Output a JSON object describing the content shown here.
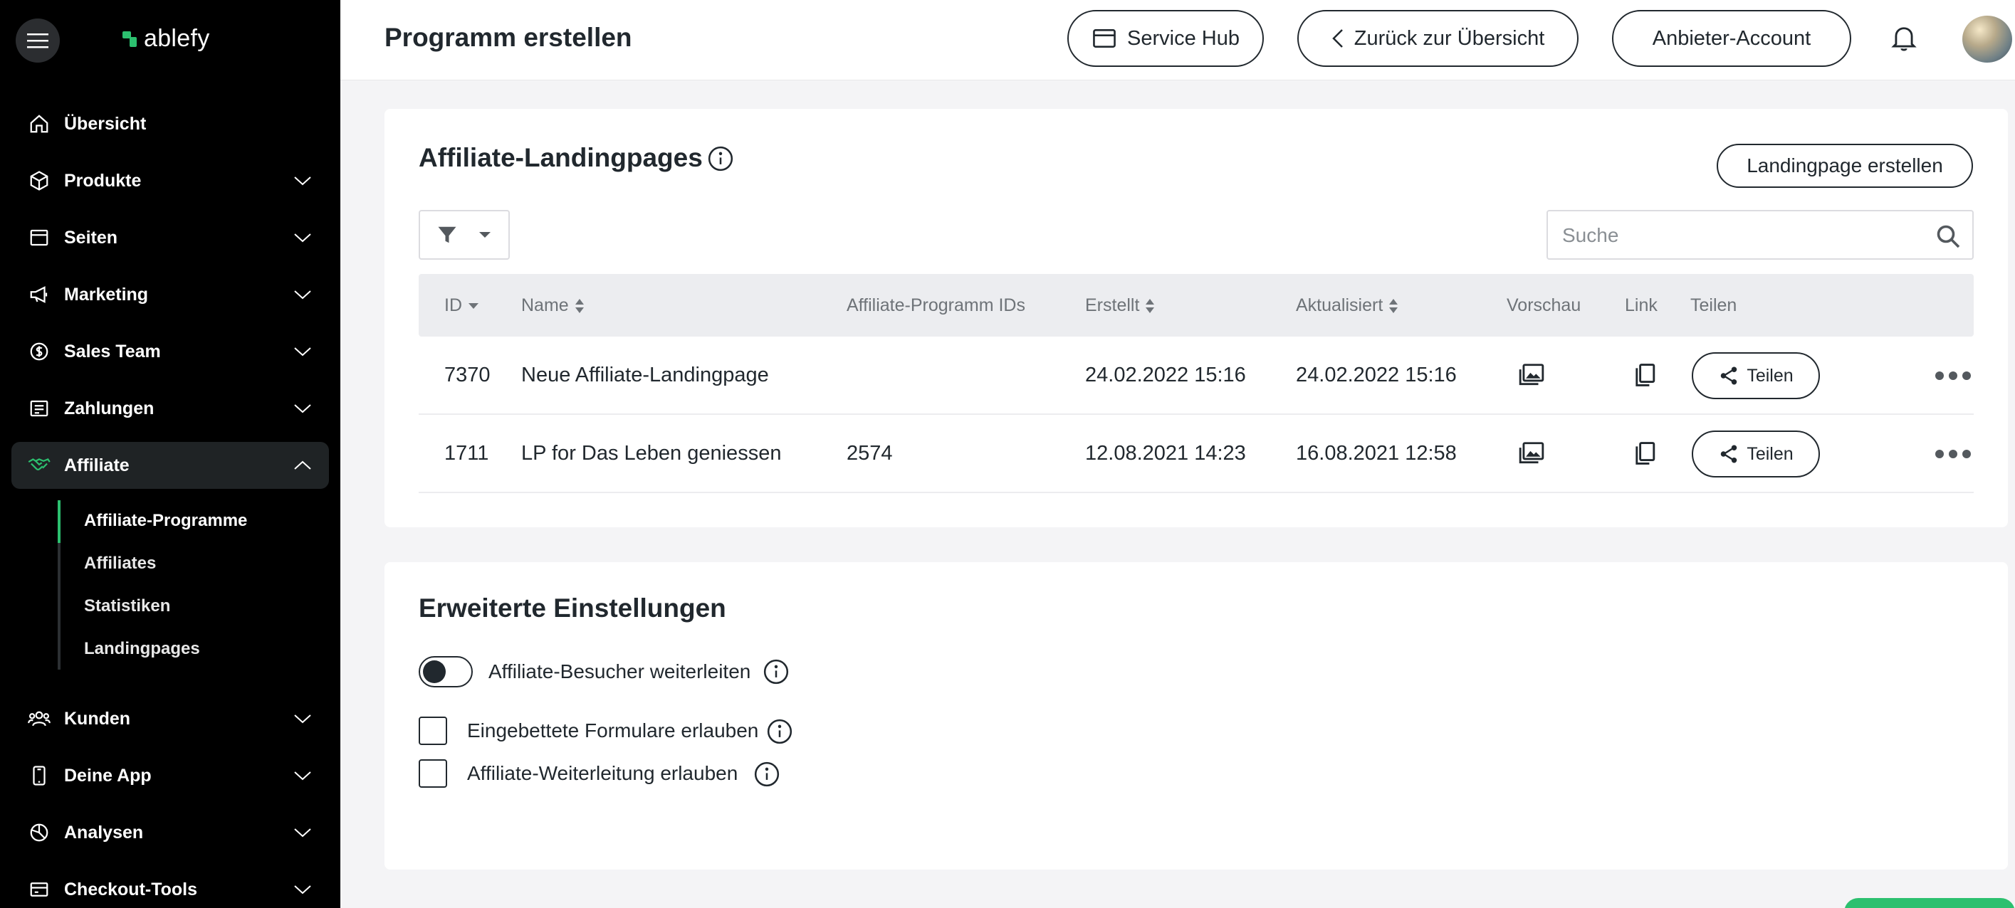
{
  "app": {
    "logo_text": "ablefy"
  },
  "sidebar": {
    "items": [
      {
        "label": "Übersicht",
        "icon": "home-icon"
      },
      {
        "label": "Produkte",
        "icon": "box-icon"
      },
      {
        "label": "Seiten",
        "icon": "layout-icon"
      },
      {
        "label": "Marketing",
        "icon": "megaphone-icon"
      },
      {
        "label": "Sales Team",
        "icon": "coin-icon"
      },
      {
        "label": "Zahlungen",
        "icon": "receipt-icon"
      },
      {
        "label": "Affiliate",
        "icon": "handshake-icon"
      },
      {
        "label": "Kunden",
        "icon": "users-icon"
      },
      {
        "label": "Deine App",
        "icon": "phone-icon"
      },
      {
        "label": "Analysen",
        "icon": "pie-chart-icon"
      },
      {
        "label": "Checkout-Tools",
        "icon": "cart-icon"
      }
    ],
    "sub_items": [
      {
        "label": "Affiliate-Programme"
      },
      {
        "label": "Affiliates"
      },
      {
        "label": "Statistiken"
      },
      {
        "label": "Landingpages"
      }
    ]
  },
  "header": {
    "title": "Programm erstellen",
    "service_hub": "Service Hub",
    "back": "Zurück zur Übersicht",
    "account": "Anbieter-Account"
  },
  "landingpages": {
    "title": "Affiliate-Landingpages",
    "create_button": "Landingpage erstellen",
    "search_placeholder": "Suche",
    "columns": {
      "id": "ID",
      "name": "Name",
      "program_ids": "Affiliate-Programm IDs",
      "created": "Erstellt",
      "updated": "Aktualisiert",
      "preview": "Vorschau",
      "link": "Link",
      "share": "Teilen"
    },
    "rows": [
      {
        "id": "7370",
        "name": "Neue Affiliate-Landingpage",
        "program_ids": "",
        "created": "24.02.2022 15:16",
        "updated": "24.02.2022 15:16",
        "share": "Teilen"
      },
      {
        "id": "1711",
        "name": "LP for Das Leben geniessen",
        "program_ids": "2574",
        "created": "12.08.2021 14:23",
        "updated": "16.08.2021 12:58",
        "share": "Teilen"
      }
    ]
  },
  "advanced": {
    "title": "Erweiterte Einstellungen",
    "redirect_visitors": {
      "label": "Affiliate-Besucher weiterleiten",
      "enabled": false
    },
    "embedded_forms": {
      "label": "Eingebettete Formulare erlauben",
      "checked": false
    },
    "affiliate_redirect": {
      "label": "Affiliate-Weiterleitung erlauben",
      "checked": false
    }
  },
  "colors": {
    "accent": "#2cc06f",
    "sidebar_bg": "#000000",
    "text": "#21282e"
  }
}
